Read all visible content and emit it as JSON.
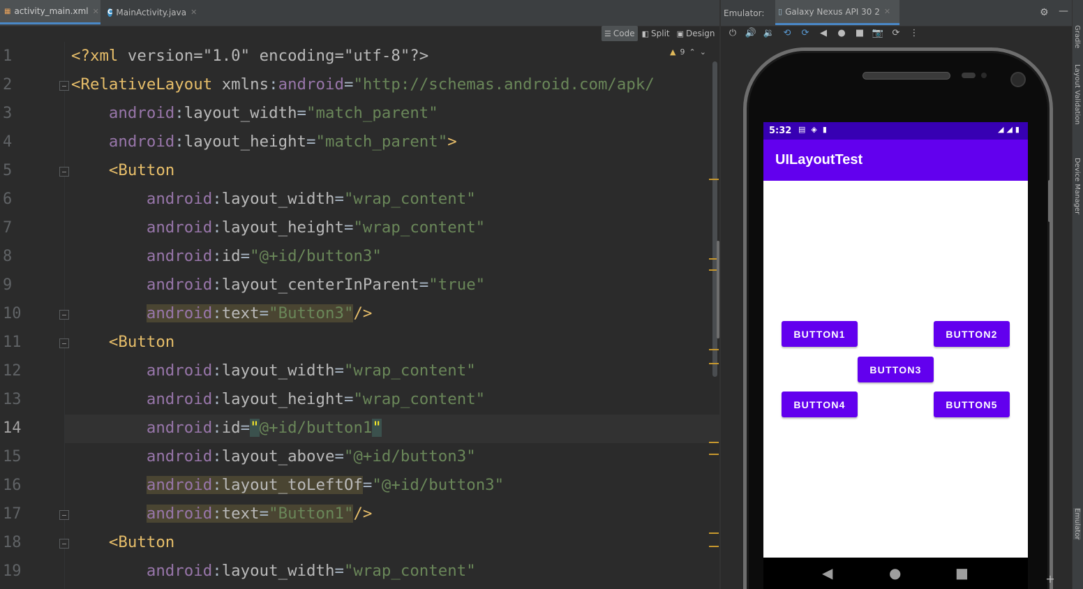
{
  "editor": {
    "tabs": [
      {
        "label": "activity_main.xml",
        "icon": "xml-file-icon",
        "active": true
      },
      {
        "label": "MainActivity.java",
        "icon": "java-class-icon",
        "active": false
      }
    ],
    "view_modes": [
      {
        "label": "Code",
        "icon": "code-view-icon",
        "active": true
      },
      {
        "label": "Split",
        "icon": "split-view-icon",
        "active": false
      },
      {
        "label": "Design",
        "icon": "design-view-icon",
        "active": false
      }
    ],
    "warning_count": "9",
    "current_line": 14,
    "line_numbers": [
      "1",
      "2",
      "3",
      "4",
      "5",
      "6",
      "7",
      "8",
      "9",
      "10",
      "11",
      "12",
      "13",
      "14",
      "15",
      "16",
      "17",
      "18",
      "19"
    ],
    "code_lines": [
      "<?xml version=\"1.0\" encoding=\"utf-8\"?>",
      "<RelativeLayout xmlns:android=\"http://schemas.android.com/apk/",
      "    android:layout_width=\"match_parent\"",
      "    android:layout_height=\"match_parent\">",
      "    <Button",
      "        android:layout_width=\"wrap_content\"",
      "        android:layout_height=\"wrap_content\"",
      "        android:id=\"@+id/button3\"",
      "        android:layout_centerInParent=\"true\"",
      "        android:text=\"Button3\"/>",
      "    <Button",
      "        android:layout_width=\"wrap_content\"",
      "        android:layout_height=\"wrap_content\"",
      "        android:id=\"@+id/button1\"",
      "        android:layout_above=\"@+id/button3\"",
      "        android:layout_toLeftOf=\"@+id/button3\"",
      "        android:text=\"Button1\"/>",
      "    <Button",
      "        android:layout_width=\"wrap_content\""
    ]
  },
  "emulator": {
    "label": "Emulator:",
    "device_tab": "Galaxy Nexus API 30 2",
    "toolbar_icons": [
      "power-icon",
      "volume-up-icon",
      "volume-down-icon",
      "rotate-left-icon",
      "rotate-right-icon",
      "back-icon",
      "home-icon",
      "overview-icon",
      "screenshot-icon",
      "snapshot-icon",
      "more-icon"
    ],
    "status_time": "5:32",
    "app_title": "UILayoutTest",
    "buttons": [
      "BUTTON1",
      "BUTTON2",
      "BUTTON3",
      "BUTTON4",
      "BUTTON5"
    ],
    "colors": {
      "status_bar": "#3700b3",
      "app_bar": "#6200ee",
      "button": "#6200ee"
    }
  },
  "right_tool_strip": [
    "Gradle",
    "Layout Validation",
    "Device Manager",
    "Emulator"
  ]
}
